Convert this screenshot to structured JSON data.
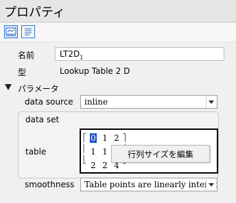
{
  "window": {
    "title": "プロパティ"
  },
  "toolbar": {
    "buttons": [
      {
        "name": "inspector-view-icon"
      },
      {
        "name": "document-view-icon"
      }
    ]
  },
  "properties": {
    "name_label": "名前",
    "name_value": "LT2D",
    "name_subscript": "1",
    "type_label": "型",
    "type_value": "Lookup Table 2 D"
  },
  "parameters": {
    "section_label": "パラメータ",
    "data_source_label": "data source",
    "data_source_value": "inline",
    "data_set_label": "data set",
    "table_label": "table",
    "table": {
      "rows": [
        [
          "0",
          "1",
          "2"
        ],
        [
          "1",
          "1",
          ""
        ],
        [
          "2",
          "2",
          "4"
        ]
      ]
    },
    "context_menu_item": "行列サイズを編集",
    "smoothness_label": "smoothness",
    "smoothness_value": "Table points are linearly interpolated"
  }
}
